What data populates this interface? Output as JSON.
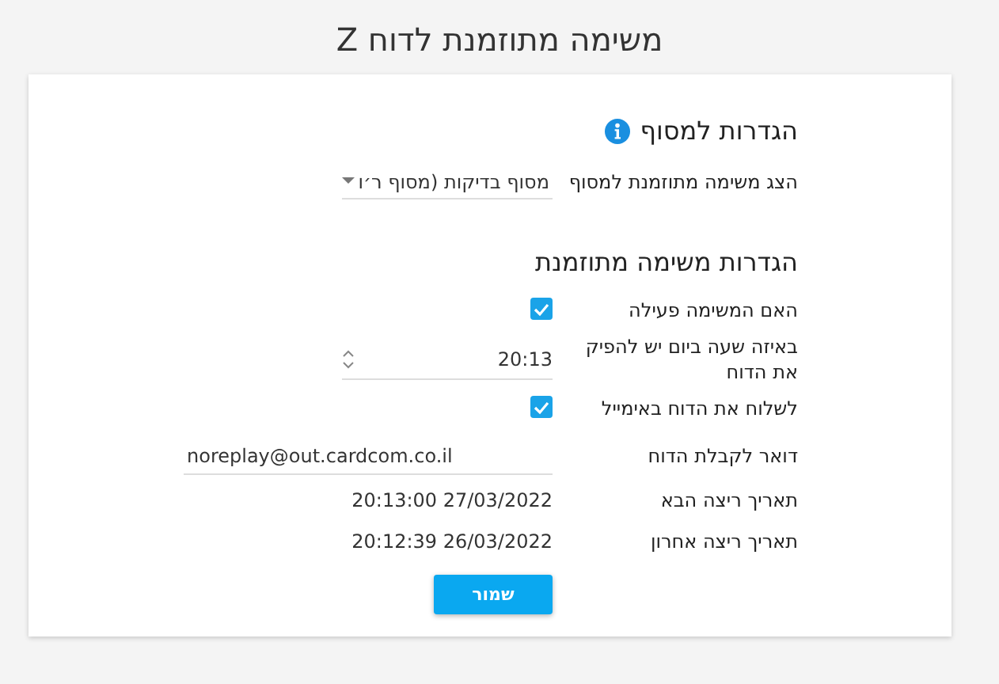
{
  "title": "משימה מתוזמנת לדוח Z",
  "sections": [
    {
      "heading": "הגדרות למסוף",
      "info_icon": true,
      "fields": [
        {
          "kind": "select",
          "label": "הצג משימה מתוזמנת למסוף",
          "value": "מסוף בדיקות (מסוף ר׳ו"
        }
      ]
    },
    {
      "heading": "הגדרות משימה מתוזמנת",
      "info_icon": false,
      "fields": [
        {
          "kind": "checkbox",
          "label": "האם המשימה פעילה",
          "checked": true
        },
        {
          "kind": "time",
          "label": "באיזה שעה ביום יש להפיק את הדוח",
          "value": "20:13"
        },
        {
          "kind": "checkbox",
          "label": "לשלוח את הדוח באימייל",
          "checked": true
        },
        {
          "kind": "text",
          "label": "דואר לקבלת הדוח",
          "value": "noreplay@out.cardcom.co.il"
        },
        {
          "kind": "readonly",
          "label": "תאריך ריצה הבא",
          "value": "20:13:00 27/03/2022"
        },
        {
          "kind": "readonly",
          "label": "תאריך ריצה אחרון",
          "value": "20:12:39 26/03/2022"
        }
      ]
    }
  ],
  "button": "שמור"
}
